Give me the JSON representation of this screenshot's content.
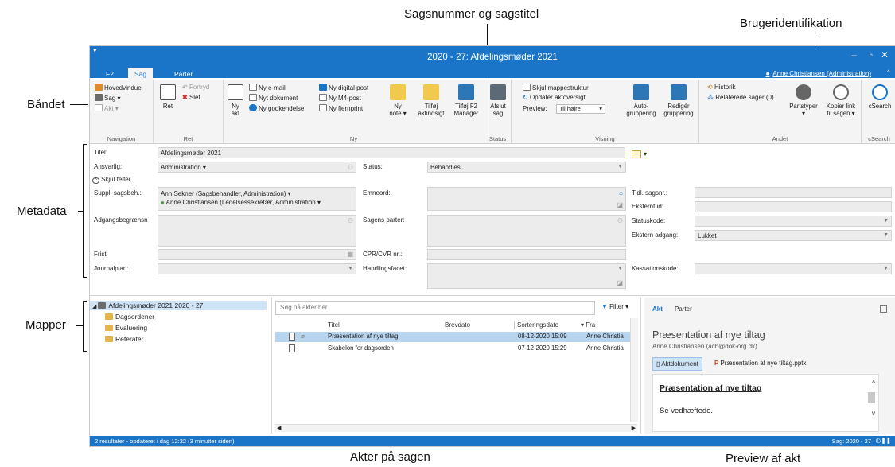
{
  "annotations": {
    "case_title": "Sagsnummer og sagstitel",
    "user_id": "Brugeridentifikation",
    "ribbon": "Båndet",
    "metadata": "Metadata",
    "folders": "Mapper",
    "documents": "Akter på sagen",
    "preview": "Preview af akt"
  },
  "window": {
    "title": "2020 - 27: Afdelingsmøder 2021",
    "quick_access": "▾",
    "user": "Anne Christiansen (Administration)",
    "minimize": "–",
    "maximize": "▫",
    "close": "✕",
    "collapse": "^"
  },
  "tabs": [
    "F2",
    "Sag",
    "Parter"
  ],
  "ribbon": {
    "navigation": {
      "label": "Navigation",
      "items": [
        "Hovedvindue",
        "Sag ▾",
        "Akt ▾"
      ]
    },
    "ret": {
      "label": "Ret",
      "big": "Ret",
      "items": [
        "Fortryd",
        "Slet"
      ]
    },
    "ny": {
      "label": "Ny",
      "big": [
        "Ny",
        "akt"
      ],
      "col1": [
        "Ny e-mail",
        "Nyt dokument",
        "Ny godkendelse"
      ],
      "col2": [
        "Ny digital post",
        "Ny M4-post",
        "Ny fjernprint"
      ]
    },
    "akter": {
      "big1": [
        "Ny",
        "note ▾"
      ],
      "big2": [
        "Tilføj",
        "aktindsigt"
      ],
      "big3": [
        "Tilføj F2",
        "Manager"
      ]
    },
    "status": {
      "label": "Status",
      "big": [
        "Afslut",
        "sag"
      ]
    },
    "visning": {
      "label": "Visning",
      "items": [
        "Skjul mappestruktur",
        "Opdater aktoversigt"
      ],
      "preview_label": "Preview:",
      "preview_value": "Til højre",
      "big1": [
        "Auto-",
        "gruppering"
      ],
      "big2": [
        "Redigér",
        "gruppering"
      ]
    },
    "andet": {
      "label": "Andet",
      "items": [
        "Historik",
        "Relaterede sager (0)"
      ],
      "big1": [
        "Partstyper",
        "▾"
      ],
      "big2": [
        "Kopier link",
        "til sagen ▾"
      ]
    },
    "csearch": {
      "label": "cSearch",
      "big": "cSearch"
    }
  },
  "metadata": {
    "title_label": "Titel:",
    "title_value": "Afdelingsmøder 2021",
    "resp_label": "Ansvarlig:",
    "resp_value": "Administration ▾",
    "status_label": "Status:",
    "status_value": "Behandles",
    "hide_fields": "Skjul felter",
    "suppl_label": "Suppl. sagsbeh.:",
    "suppl_1": "Ann Sekner (Sagsbehandler, Administration) ▾",
    "suppl_2": "Anne Christiansen (Ledelsessekretær, Administration ▾",
    "emneord_label": "Emneord:",
    "access_label": "Adgangsbegrænsn",
    "parter_label": "Sagens parter:",
    "frist_label": "Frist:",
    "cpr_label": "CPR/CVR nr.:",
    "journal_label": "Journalplan:",
    "handling_label": "Handlingsfacet:",
    "prev_caseno_label": "Tidl. sagsnr.:",
    "ext_id_label": "Eksternt id:",
    "status_code_label": "Statuskode:",
    "ext_access_label": "Ekstern adgang:",
    "ext_access_value": "Lukket",
    "kassation_label": "Kassationskode:"
  },
  "tree": {
    "root": "Afdelingsmøder 2021 2020 - 27",
    "children": [
      "Dagsordener",
      "Evaluering",
      "Referater"
    ]
  },
  "list": {
    "search_placeholder": "Søg på akter her",
    "filter": "Filter ▾",
    "columns": [
      "Titel",
      "Brevdato",
      "Sorteringsdato",
      "▾ Fra"
    ],
    "rows": [
      {
        "title": "Præsentation af nye tiltag",
        "brevdato": "",
        "sortdato": "08-12-2020 15:09",
        "fra": "Anne Christia"
      },
      {
        "title": "Skabelon for dagsorden",
        "brevdato": "",
        "sortdato": "07-12-2020 15:29",
        "fra": "Anne Christia"
      }
    ]
  },
  "preview": {
    "tabs": [
      "Akt",
      "Parter"
    ],
    "title": "Præsentation af nye tiltag",
    "author": "Anne Christiansen (ach@dok-org.dk)",
    "doc_button": "Aktdokument",
    "attachment": "Præsentation af nye tiltag.pptx",
    "doc_heading": "Præsentation af nye tiltag",
    "doc_body": "Se vedhæftede."
  },
  "status": {
    "left": "2 resultater - opdateret i dag 12:32 (3 minutter siden)",
    "right": "Sag: 2020 - 27"
  }
}
